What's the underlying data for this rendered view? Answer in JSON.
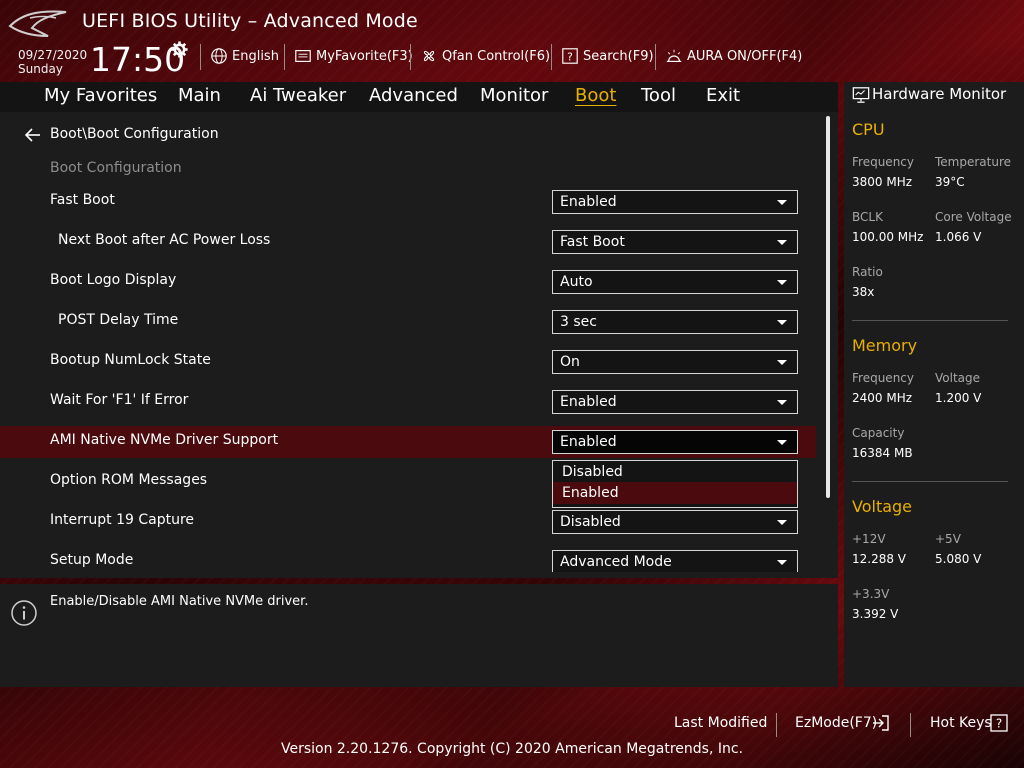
{
  "header": {
    "title": "UEFI BIOS Utility – Advanced Mode",
    "date": "09/27/2020",
    "day": "Sunday",
    "time": "17:50",
    "toolbar": {
      "language": "English",
      "my_favorite": "MyFavorite(F3)",
      "qfan": "Qfan Control(F6)",
      "search": "Search(F9)",
      "aura": "AURA ON/OFF(F4)"
    }
  },
  "menu": {
    "items": [
      "My Favorites",
      "Main",
      "Ai Tweaker",
      "Advanced",
      "Monitor",
      "Boot",
      "Tool",
      "Exit"
    ],
    "active": "Boot"
  },
  "main": {
    "breadcrumb": "Boot\\Boot Configuration",
    "section": "Boot Configuration",
    "settings": [
      {
        "label": "Fast Boot",
        "value": "Enabled"
      },
      {
        "label": "Next Boot after AC Power Loss",
        "value": "Fast Boot"
      },
      {
        "label": "Boot Logo Display",
        "value": "Auto"
      },
      {
        "label": "POST Delay Time",
        "value": "3 sec"
      },
      {
        "label": "Bootup NumLock State",
        "value": "On"
      },
      {
        "label": "Wait For 'F1' If Error",
        "value": "Enabled"
      },
      {
        "label": "AMI Native NVMe Driver Support",
        "value": "Enabled"
      },
      {
        "label": "Option ROM Messages",
        "value": ""
      },
      {
        "label": "Interrupt 19 Capture",
        "value": "Disabled"
      },
      {
        "label": "Setup Mode",
        "value": "Advanced Mode"
      }
    ],
    "dropdown": {
      "options": [
        "Disabled",
        "Enabled"
      ],
      "selected": "Enabled"
    },
    "help": "Enable/Disable AMI Native NVMe driver."
  },
  "monitor": {
    "title": "Hardware Monitor",
    "cpu": {
      "heading": "CPU",
      "frequency_label": "Frequency",
      "frequency": "3800 MHz",
      "temperature_label": "Temperature",
      "temperature": "39°C",
      "bclk_label": "BCLK",
      "bclk": "100.00 MHz",
      "core_voltage_label": "Core Voltage",
      "core_voltage": "1.066 V",
      "ratio_label": "Ratio",
      "ratio": "38x"
    },
    "memory": {
      "heading": "Memory",
      "frequency_label": "Frequency",
      "frequency": "2400 MHz",
      "voltage_label": "Voltage",
      "voltage": "1.200 V",
      "capacity_label": "Capacity",
      "capacity": "16384 MB"
    },
    "voltage": {
      "heading": "Voltage",
      "v12_label": "+12V",
      "v12": "12.288 V",
      "v5_label": "+5V",
      "v5": "5.080 V",
      "v33_label": "+3.3V",
      "v33": "3.392 V"
    }
  },
  "footer": {
    "last_modified": "Last Modified",
    "ezmode": "EzMode(F7)",
    "hotkeys": "Hot Keys",
    "copyright": "Version 2.20.1276. Copyright (C) 2020 American Megatrends, Inc."
  },
  "colors": {
    "accent": "#e9b000",
    "highlight_row": "#4a0a0e",
    "panel": "#1c1c1c"
  }
}
